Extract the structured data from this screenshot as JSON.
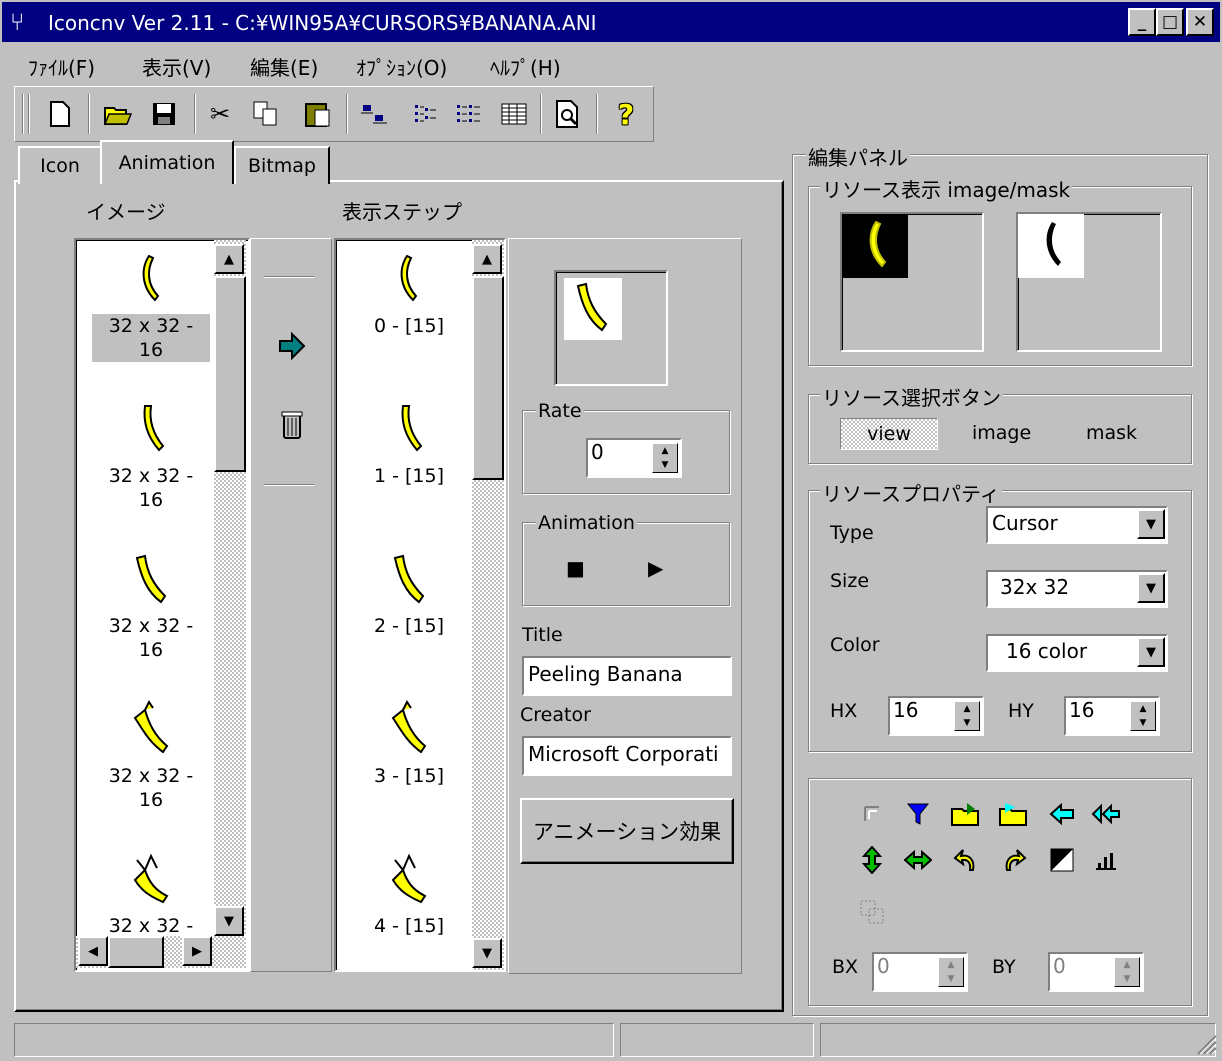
{
  "window": {
    "title": "Iconcnv Ver 2.11 - C:¥WIN95A¥CURSORS¥BANANA.ANI",
    "minimize": "_",
    "maximize": "□",
    "close": "✕"
  },
  "menu": [
    {
      "label": "ﾌｧｲﾙ(F)"
    },
    {
      "label": "表示(V)"
    },
    {
      "label": "編集(E)"
    },
    {
      "label": "ｵﾌﾟｼｮﾝ(O)"
    },
    {
      "label": "ﾍﾙﾌﾟ(H)"
    }
  ],
  "toolbar": [
    {
      "icon": "new-file-icon",
      "glyph": "🗋"
    },
    {
      "icon": "open-folder-icon",
      "glyph": "📂"
    },
    {
      "icon": "save-icon",
      "glyph": "💾"
    },
    {
      "icon": "cut-icon",
      "glyph": "✂"
    },
    {
      "icon": "copy-icon",
      "glyph": "⎘"
    },
    {
      "icon": "paste-icon",
      "glyph": "📋"
    },
    {
      "icon": "large-icons-icon",
      "glyph": "▫"
    },
    {
      "icon": "small-icons-icon",
      "glyph": "⁝"
    },
    {
      "icon": "list-view-icon",
      "glyph": "☷"
    },
    {
      "icon": "details-view-icon",
      "glyph": "▦"
    },
    {
      "icon": "preview-icon",
      "glyph": "🔍"
    },
    {
      "icon": "help-icon",
      "glyph": "?"
    }
  ],
  "tabs": [
    {
      "label": "Icon"
    },
    {
      "label": "Animation"
    },
    {
      "label": "Bitmap"
    }
  ],
  "animation": {
    "image_heading": "イメージ",
    "steps_heading": "表示ステップ",
    "image_items": [
      {
        "line1": "32 x 32 -",
        "line2": "16"
      },
      {
        "line1": "32 x 32 -",
        "line2": "16"
      },
      {
        "line1": "32 x 32 -",
        "line2": "16"
      },
      {
        "line1": "32 x 32 -",
        "line2": "16"
      },
      {
        "line1": "32 x 32 -",
        "line2": ""
      }
    ],
    "step_items": [
      {
        "label": "0 - [15]"
      },
      {
        "label": "1 - [15]"
      },
      {
        "label": "2 - [15]"
      },
      {
        "label": "3 - [15]"
      },
      {
        "label": "4 - [15]"
      }
    ],
    "rate_label": "Rate",
    "rate_value": "0",
    "anim_label": "Animation",
    "stop_glyph": "■",
    "play_glyph": "▶",
    "title_label": "Title",
    "title_value": "Peeling Banana",
    "creator_label": "Creator",
    "creator_value": "Microsoft Corporati",
    "effect_button": "アニメーション効果"
  },
  "edit_panel": {
    "title": "編集パネル",
    "resource_view_label": "リソース表示 image/mask",
    "select_buttons_label": "リソース選択ボタン",
    "view_btn": "view",
    "image_btn": "image",
    "mask_btn": "mask",
    "properties_label": "リソースプロパティ",
    "type_label": "Type",
    "type_value": "Cursor",
    "size_label": "Size",
    "size_value": "32x 32",
    "color_label": "Color",
    "color_value": "16 color",
    "hx_label": "HX",
    "hx_value": "16",
    "hy_label": "HY",
    "hy_value": "16",
    "bx_label": "BX",
    "bx_value": "0",
    "by_label": "BY",
    "by_value": "0"
  },
  "colors": {
    "face": "#c0c0c0",
    "titlebar": "#000080",
    "banana": "#ffff00",
    "arrow": "#008080"
  }
}
